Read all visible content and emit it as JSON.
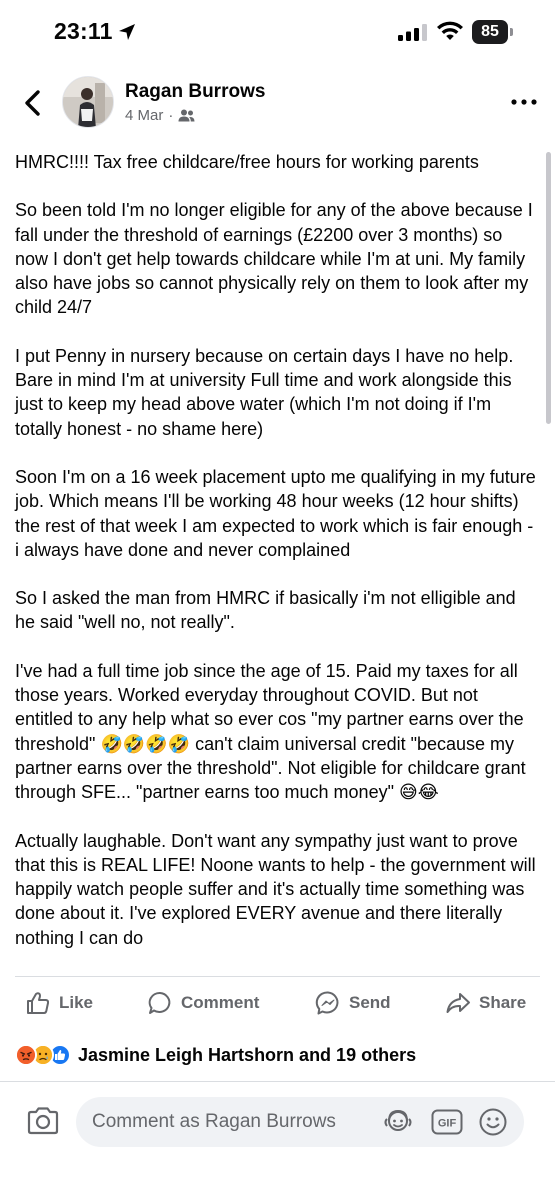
{
  "status_bar": {
    "time": "23:11",
    "battery": "85"
  },
  "post": {
    "author": "Ragan Burrows",
    "date": "4 Mar",
    "meta_separator": "·",
    "audience_icon": "friends-icon",
    "paragraphs": [
      "HMRC!!!! Tax free childcare/free hours for working parents",
      "So been told I'm no longer eligible for any of the above because I fall under the threshold of earnings (£2200 over 3 months) so now I don't get help towards childcare while I'm at uni. My family also have jobs so cannot physically rely on them to look after my child 24/7",
      "I put Penny in nursery because on certain days I have no help. Bare in mind I'm at university Full time and work alongside this just to keep my head above water (which I'm not doing if I'm totally honest - no shame here)",
      "Soon I'm on a 16 week placement upto me qualifying in my future job. Which means I'll be working 48 hour weeks (12 hour shifts) the rest of that week I am expected to work which is fair enough - i always have done and never complained",
      "So I asked the man from HMRC if basically i'm not elligible and he said \"well no, not really\".",
      "I've had a full time job since the age of 15. Paid my taxes for all those years. Worked everyday throughout COVID. But not entitled to any help what so ever cos \"my partner earns over the threshold\" 🤣🤣🤣🤣 can't claim universal credit \"because my partner earns over the threshold\". Not eligible for childcare grant through SFE... \"partner earns too much money\" 😅😂",
      "Actually laughable. Don't want any sympathy just want to prove that this is REAL LIFE! Noone wants to help - the government will happily watch people suffer and it's actually time something was done about it. I've explored EVERY avenue and there literally nothing I can do"
    ]
  },
  "actions": {
    "like": "Like",
    "comment": "Comment",
    "send": "Send",
    "share": "Share"
  },
  "reactions": {
    "icons": [
      "angry",
      "sad",
      "like"
    ],
    "label": "Jasmine Leigh Hartshorn and 19 others"
  },
  "comment_bar": {
    "placeholder": "Comment as Ragan Burrows",
    "gif": "GIF"
  },
  "colors": {
    "secondary_text": "#65676b",
    "comment_bg": "#f0f2f5",
    "like_blue": "#1877f2",
    "angry_orange": "#f7714b",
    "sad_yellow": "#f7b125"
  }
}
